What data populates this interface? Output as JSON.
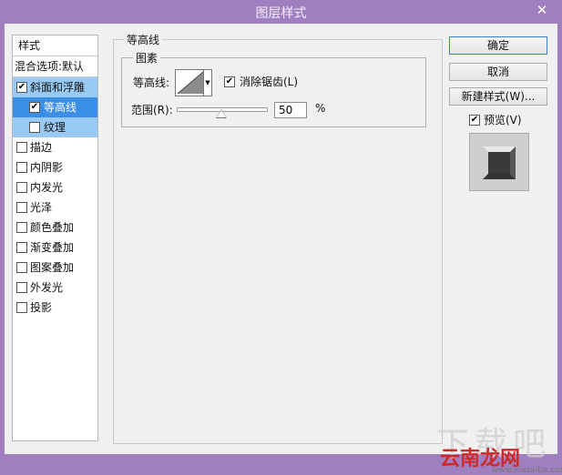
{
  "window": {
    "title": "图层样式",
    "close_glyph": "✕"
  },
  "styles_panel": {
    "header": "样式",
    "blend_options": "混合选项:默认",
    "items": [
      {
        "label": "斜面和浮雕",
        "checked": true
      },
      {
        "label": "等高线",
        "checked": true
      },
      {
        "label": "纹理",
        "checked": false
      },
      {
        "label": "描边",
        "checked": false
      },
      {
        "label": "内阴影",
        "checked": false
      },
      {
        "label": "内发光",
        "checked": false
      },
      {
        "label": "光泽",
        "checked": false
      },
      {
        "label": "颜色叠加",
        "checked": false
      },
      {
        "label": "渐变叠加",
        "checked": false
      },
      {
        "label": "图案叠加",
        "checked": false
      },
      {
        "label": "外发光",
        "checked": false
      },
      {
        "label": "投影",
        "checked": false
      }
    ]
  },
  "contour_section": {
    "title": "等高线",
    "group_title": "图素",
    "contour_label": "等高线:",
    "antialias_label": "消除锯齿(L)",
    "antialias_checked": true,
    "range_label": "范围(R):",
    "range_value": "50",
    "range_unit": "%",
    "range_fraction": 0.5
  },
  "buttons": {
    "ok": "确定",
    "cancel": "取消",
    "new_style": "新建样式(W)...",
    "preview_label": "预览(V)",
    "preview_checked": true
  },
  "watermark": {
    "faint": "下载吧",
    "main": "云南龙网",
    "sub": "www.xiazaiba.com"
  },
  "colors": {
    "titlebar": "#a07fc0",
    "selection": "#3a8ee6",
    "selection_light": "#99c9f5"
  }
}
